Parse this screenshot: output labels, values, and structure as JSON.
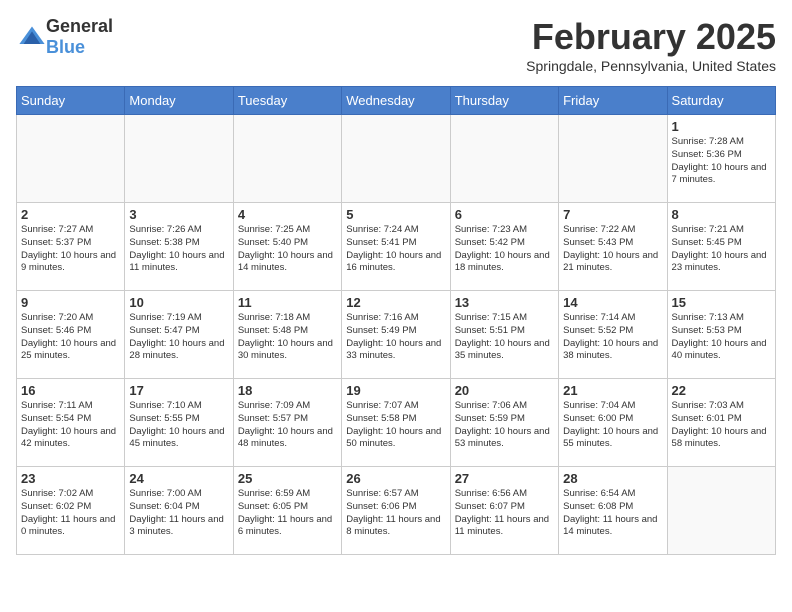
{
  "header": {
    "logo_general": "General",
    "logo_blue": "Blue",
    "month_title": "February 2025",
    "location": "Springdale, Pennsylvania, United States"
  },
  "weekdays": [
    "Sunday",
    "Monday",
    "Tuesday",
    "Wednesday",
    "Thursday",
    "Friday",
    "Saturday"
  ],
  "weeks": [
    [
      {
        "day": "",
        "info": ""
      },
      {
        "day": "",
        "info": ""
      },
      {
        "day": "",
        "info": ""
      },
      {
        "day": "",
        "info": ""
      },
      {
        "day": "",
        "info": ""
      },
      {
        "day": "",
        "info": ""
      },
      {
        "day": "1",
        "info": "Sunrise: 7:28 AM\nSunset: 5:36 PM\nDaylight: 10 hours\nand 7 minutes."
      }
    ],
    [
      {
        "day": "2",
        "info": "Sunrise: 7:27 AM\nSunset: 5:37 PM\nDaylight: 10 hours\nand 9 minutes."
      },
      {
        "day": "3",
        "info": "Sunrise: 7:26 AM\nSunset: 5:38 PM\nDaylight: 10 hours\nand 11 minutes."
      },
      {
        "day": "4",
        "info": "Sunrise: 7:25 AM\nSunset: 5:40 PM\nDaylight: 10 hours\nand 14 minutes."
      },
      {
        "day": "5",
        "info": "Sunrise: 7:24 AM\nSunset: 5:41 PM\nDaylight: 10 hours\nand 16 minutes."
      },
      {
        "day": "6",
        "info": "Sunrise: 7:23 AM\nSunset: 5:42 PM\nDaylight: 10 hours\nand 18 minutes."
      },
      {
        "day": "7",
        "info": "Sunrise: 7:22 AM\nSunset: 5:43 PM\nDaylight: 10 hours\nand 21 minutes."
      },
      {
        "day": "8",
        "info": "Sunrise: 7:21 AM\nSunset: 5:45 PM\nDaylight: 10 hours\nand 23 minutes."
      }
    ],
    [
      {
        "day": "9",
        "info": "Sunrise: 7:20 AM\nSunset: 5:46 PM\nDaylight: 10 hours\nand 25 minutes."
      },
      {
        "day": "10",
        "info": "Sunrise: 7:19 AM\nSunset: 5:47 PM\nDaylight: 10 hours\nand 28 minutes."
      },
      {
        "day": "11",
        "info": "Sunrise: 7:18 AM\nSunset: 5:48 PM\nDaylight: 10 hours\nand 30 minutes."
      },
      {
        "day": "12",
        "info": "Sunrise: 7:16 AM\nSunset: 5:49 PM\nDaylight: 10 hours\nand 33 minutes."
      },
      {
        "day": "13",
        "info": "Sunrise: 7:15 AM\nSunset: 5:51 PM\nDaylight: 10 hours\nand 35 minutes."
      },
      {
        "day": "14",
        "info": "Sunrise: 7:14 AM\nSunset: 5:52 PM\nDaylight: 10 hours\nand 38 minutes."
      },
      {
        "day": "15",
        "info": "Sunrise: 7:13 AM\nSunset: 5:53 PM\nDaylight: 10 hours\nand 40 minutes."
      }
    ],
    [
      {
        "day": "16",
        "info": "Sunrise: 7:11 AM\nSunset: 5:54 PM\nDaylight: 10 hours\nand 42 minutes."
      },
      {
        "day": "17",
        "info": "Sunrise: 7:10 AM\nSunset: 5:55 PM\nDaylight: 10 hours\nand 45 minutes."
      },
      {
        "day": "18",
        "info": "Sunrise: 7:09 AM\nSunset: 5:57 PM\nDaylight: 10 hours\nand 48 minutes."
      },
      {
        "day": "19",
        "info": "Sunrise: 7:07 AM\nSunset: 5:58 PM\nDaylight: 10 hours\nand 50 minutes."
      },
      {
        "day": "20",
        "info": "Sunrise: 7:06 AM\nSunset: 5:59 PM\nDaylight: 10 hours\nand 53 minutes."
      },
      {
        "day": "21",
        "info": "Sunrise: 7:04 AM\nSunset: 6:00 PM\nDaylight: 10 hours\nand 55 minutes."
      },
      {
        "day": "22",
        "info": "Sunrise: 7:03 AM\nSunset: 6:01 PM\nDaylight: 10 hours\nand 58 minutes."
      }
    ],
    [
      {
        "day": "23",
        "info": "Sunrise: 7:02 AM\nSunset: 6:02 PM\nDaylight: 11 hours\nand 0 minutes."
      },
      {
        "day": "24",
        "info": "Sunrise: 7:00 AM\nSunset: 6:04 PM\nDaylight: 11 hours\nand 3 minutes."
      },
      {
        "day": "25",
        "info": "Sunrise: 6:59 AM\nSunset: 6:05 PM\nDaylight: 11 hours\nand 6 minutes."
      },
      {
        "day": "26",
        "info": "Sunrise: 6:57 AM\nSunset: 6:06 PM\nDaylight: 11 hours\nand 8 minutes."
      },
      {
        "day": "27",
        "info": "Sunrise: 6:56 AM\nSunset: 6:07 PM\nDaylight: 11 hours\nand 11 minutes."
      },
      {
        "day": "28",
        "info": "Sunrise: 6:54 AM\nSunset: 6:08 PM\nDaylight: 11 hours\nand 14 minutes."
      },
      {
        "day": "",
        "info": ""
      }
    ]
  ]
}
